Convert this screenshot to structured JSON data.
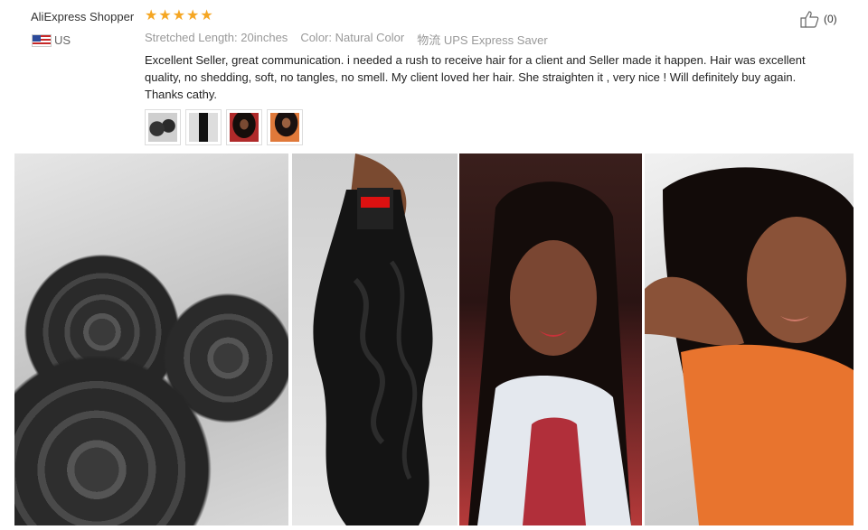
{
  "review": {
    "reviewer_name": "AliExpress Shopper",
    "rating_stars": 5,
    "country": "US",
    "attributes": [
      {
        "key": "Stretched Length:",
        "value": "20inches"
      },
      {
        "key": "Color:",
        "value": "Natural Color"
      },
      {
        "key": "物流",
        "value": "UPS Express Saver"
      }
    ],
    "text": "Excellent Seller, great communication. i needed a rush to receive hair for a client and Seller made it happen. Hair was excellent quality, no shedding, soft, no tangles, no smell. My client loved her hair.  She straighten it , very nice ! Will definitely buy again. Thanks cathy.",
    "likes": "(0)"
  },
  "thumbnails": [
    "thumb-hair-bundles",
    "thumb-body-wave-bundle",
    "thumb-customer-selfie-1",
    "thumb-customer-selfie-2"
  ],
  "photos": [
    "photo-hair-bundles",
    "photo-body-wave-bundle",
    "photo-customer-selfie-1",
    "photo-customer-selfie-2"
  ],
  "colors": {
    "star": "#f5a623",
    "text": "#222222",
    "muted": "#999999"
  }
}
